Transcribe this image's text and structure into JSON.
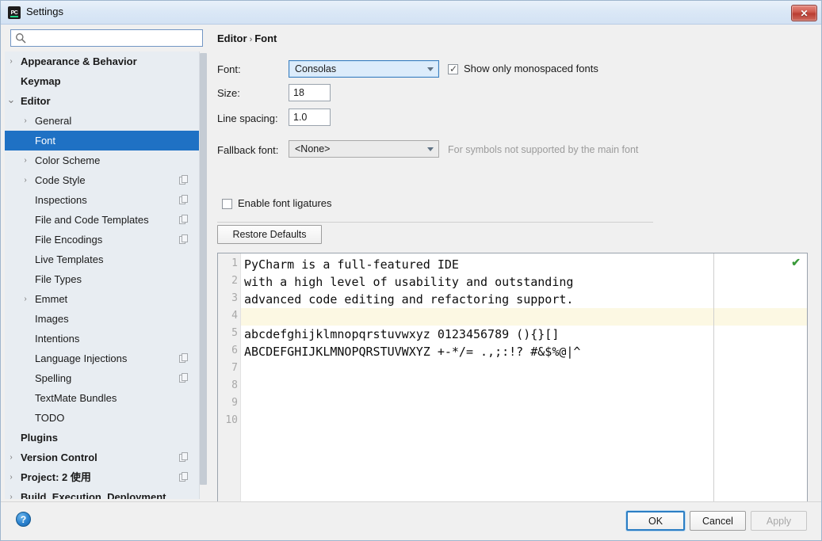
{
  "window": {
    "title": "Settings",
    "app_icon": "pycharm-icon",
    "close_label": "✕"
  },
  "search": {
    "value": "",
    "placeholder": "",
    "icon": "search-icon"
  },
  "sidebar": {
    "items": [
      {
        "label": "Appearance & Behavior",
        "depth": 0,
        "arrow": "collapsed",
        "bold": true,
        "selected": false,
        "copy_icon": false
      },
      {
        "label": "Keymap",
        "depth": 0,
        "arrow": "none",
        "bold": true,
        "selected": false,
        "copy_icon": false
      },
      {
        "label": "Editor",
        "depth": 0,
        "arrow": "expanded",
        "bold": true,
        "selected": false,
        "copy_icon": false
      },
      {
        "label": "General",
        "depth": 1,
        "arrow": "collapsed",
        "bold": false,
        "selected": false,
        "copy_icon": false
      },
      {
        "label": "Font",
        "depth": 1,
        "arrow": "none",
        "bold": false,
        "selected": true,
        "copy_icon": false
      },
      {
        "label": "Color Scheme",
        "depth": 1,
        "arrow": "collapsed",
        "bold": false,
        "selected": false,
        "copy_icon": false
      },
      {
        "label": "Code Style",
        "depth": 1,
        "arrow": "collapsed",
        "bold": false,
        "selected": false,
        "copy_icon": true
      },
      {
        "label": "Inspections",
        "depth": 1,
        "arrow": "none",
        "bold": false,
        "selected": false,
        "copy_icon": true
      },
      {
        "label": "File and Code Templates",
        "depth": 1,
        "arrow": "none",
        "bold": false,
        "selected": false,
        "copy_icon": true
      },
      {
        "label": "File Encodings",
        "depth": 1,
        "arrow": "none",
        "bold": false,
        "selected": false,
        "copy_icon": true
      },
      {
        "label": "Live Templates",
        "depth": 1,
        "arrow": "none",
        "bold": false,
        "selected": false,
        "copy_icon": false
      },
      {
        "label": "File Types",
        "depth": 1,
        "arrow": "none",
        "bold": false,
        "selected": false,
        "copy_icon": false
      },
      {
        "label": "Emmet",
        "depth": 1,
        "arrow": "collapsed",
        "bold": false,
        "selected": false,
        "copy_icon": false
      },
      {
        "label": "Images",
        "depth": 1,
        "arrow": "none",
        "bold": false,
        "selected": false,
        "copy_icon": false
      },
      {
        "label": "Intentions",
        "depth": 1,
        "arrow": "none",
        "bold": false,
        "selected": false,
        "copy_icon": false
      },
      {
        "label": "Language Injections",
        "depth": 1,
        "arrow": "none",
        "bold": false,
        "selected": false,
        "copy_icon": true
      },
      {
        "label": "Spelling",
        "depth": 1,
        "arrow": "none",
        "bold": false,
        "selected": false,
        "copy_icon": true
      },
      {
        "label": "TextMate Bundles",
        "depth": 1,
        "arrow": "none",
        "bold": false,
        "selected": false,
        "copy_icon": false
      },
      {
        "label": "TODO",
        "depth": 1,
        "arrow": "none",
        "bold": false,
        "selected": false,
        "copy_icon": false
      },
      {
        "label": "Plugins",
        "depth": 0,
        "arrow": "none",
        "bold": true,
        "selected": false,
        "copy_icon": false
      },
      {
        "label": "Version Control",
        "depth": 0,
        "arrow": "collapsed",
        "bold": true,
        "selected": false,
        "copy_icon": true
      },
      {
        "label": "Project: 2 使用",
        "depth": 0,
        "arrow": "collapsed",
        "bold": true,
        "selected": false,
        "copy_icon": true
      },
      {
        "label": "Build, Execution, Deployment",
        "depth": 0,
        "arrow": "collapsed",
        "bold": true,
        "selected": false,
        "copy_icon": false
      }
    ]
  },
  "breadcrumb": {
    "root": "Editor",
    "separator": "›",
    "leaf": "Font"
  },
  "form": {
    "font_label": "Font:",
    "font_value": "Consolas",
    "monospaced_label": "Show only monospaced fonts",
    "monospaced_checked": true,
    "size_label": "Size:",
    "size_value": "18",
    "line_spacing_label": "Line spacing:",
    "line_spacing_value": "1.0",
    "fallback_label": "Fallback font:",
    "fallback_value": "<None>",
    "fallback_hint": "For symbols not supported by the main font",
    "ligatures_label": "Enable font ligatures",
    "ligatures_checked": false,
    "restore_defaults_label": "Restore Defaults"
  },
  "preview": {
    "inspection_status_icon": "check-mark-icon",
    "caret_line": 4,
    "lines": [
      {
        "number": "1",
        "text": "PyCharm is a full-featured IDE"
      },
      {
        "number": "2",
        "text": "with a high level of usability and outstanding"
      },
      {
        "number": "3",
        "text": "advanced code editing and refactoring support."
      },
      {
        "number": "4",
        "text": ""
      },
      {
        "number": "5",
        "text": "abcdefghijklmnopqrstuvwxyz 0123456789 (){}[]"
      },
      {
        "number": "6",
        "text": "ABCDEFGHIJKLMNOPQRSTUVWXYZ +-*/= .,;:!? #&$%@|^"
      },
      {
        "number": "7",
        "text": ""
      },
      {
        "number": "8",
        "text": ""
      },
      {
        "number": "9",
        "text": ""
      },
      {
        "number": "10",
        "text": ""
      }
    ]
  },
  "footer": {
    "help_label": "?",
    "ok_label": "OK",
    "cancel_label": "Cancel",
    "apply_label": "Apply",
    "apply_enabled": false
  },
  "colors": {
    "selection_blue": "#1f71c4",
    "titlebar_blue": "#dbe8f6",
    "sidebar_bg": "#e8edf2",
    "panel_bg": "#f0f0f0",
    "caret_line_yellow": "#fcf8e3",
    "close_red": "#ba3d32",
    "inspect_green": "#3a9a3a",
    "hint_gray": "#9b9b9b"
  }
}
